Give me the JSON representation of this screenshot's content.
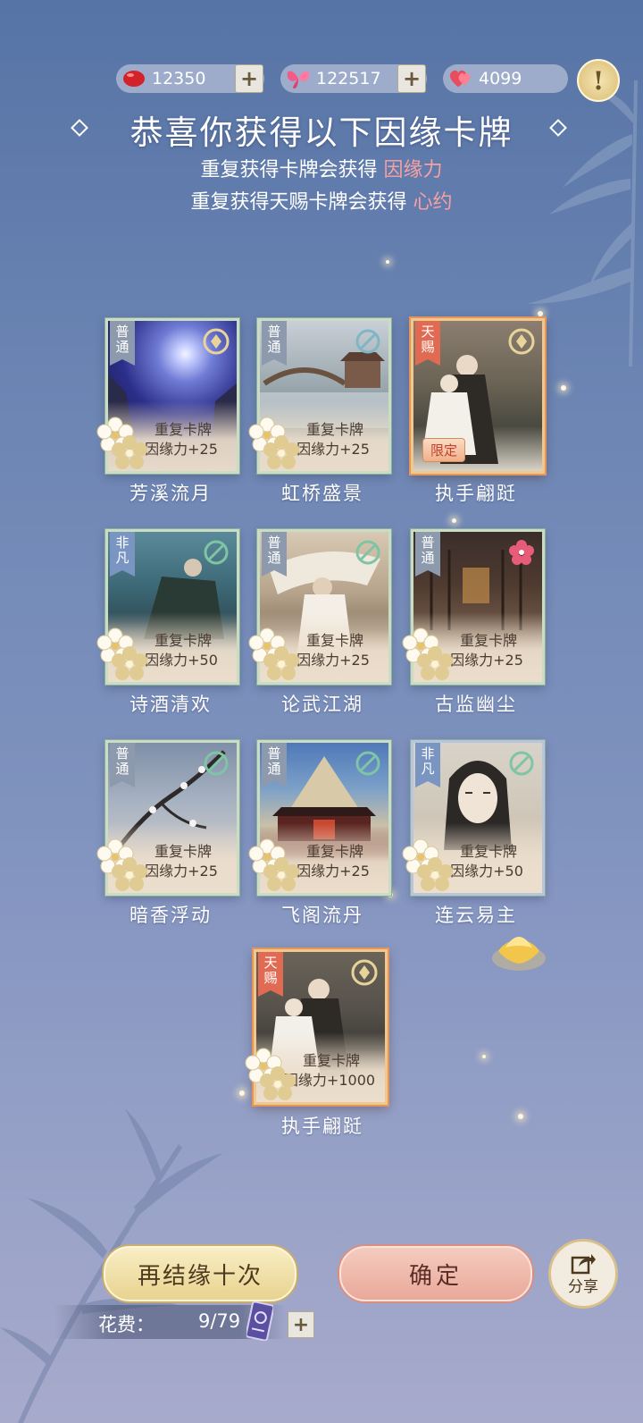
{
  "currencies": [
    {
      "name": "red-bean",
      "value": "12350"
    },
    {
      "name": "butterfly",
      "value": "122517"
    },
    {
      "name": "heart",
      "value": "4099"
    }
  ],
  "hint_symbol": "!",
  "header": {
    "title": "恭喜你获得以下因缘卡牌",
    "line1_prefix": "重复获得卡牌会获得",
    "line1_highlight": "因缘力",
    "line2_prefix": "重复获得天赐卡牌会获得",
    "line2_highlight": "心约"
  },
  "cards": [
    {
      "rarity": "普通",
      "name": "芳溪流月",
      "dup": "重复卡牌",
      "gain": "因缘力+25"
    },
    {
      "rarity": "普通",
      "name": "虹桥盛景",
      "dup": "重复卡牌",
      "gain": "因缘力+25"
    },
    {
      "rarity": "天赐",
      "name": "执手翩跹",
      "badge": "限定"
    },
    {
      "rarity": "非凡",
      "name": "诗酒清欢",
      "dup": "重复卡牌",
      "gain": "因缘力+50"
    },
    {
      "rarity": "普通",
      "name": "论武江湖",
      "dup": "重复卡牌",
      "gain": "因缘力+25"
    },
    {
      "rarity": "普通",
      "name": "古监幽尘",
      "dup": "重复卡牌",
      "gain": "因缘力+25"
    },
    {
      "rarity": "普通",
      "name": "暗香浮动",
      "dup": "重复卡牌",
      "gain": "因缘力+25"
    },
    {
      "rarity": "普通",
      "name": "飞阁流丹",
      "dup": "重复卡牌",
      "gain": "因缘力+25"
    },
    {
      "rarity": "非凡",
      "name": "连云易主",
      "dup": "重复卡牌",
      "gain": "因缘力+50"
    },
    {
      "rarity": "天赐",
      "name": "执手翩跹",
      "dup": "重复卡牌",
      "gain": "因缘力+1000"
    }
  ],
  "buttons": {
    "again": "再结缘十次",
    "confirm": "确定",
    "share": "分享"
  },
  "cost": {
    "label": "花费：",
    "value": "9/79",
    "plus": "+"
  },
  "plus_symbol": "+",
  "colors": {
    "highlight": "#f6a0a2",
    "common_tag": "#8d99ac",
    "rare_tag": "#7b95c2",
    "divine_tag": "#e06a52"
  }
}
